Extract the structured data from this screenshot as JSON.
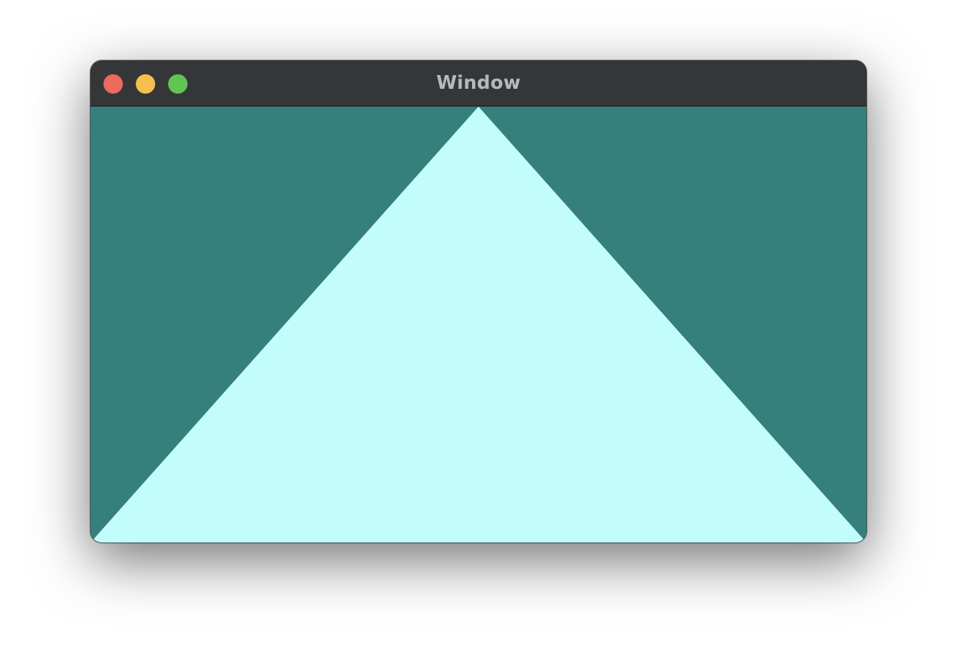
{
  "window": {
    "title": "Window"
  },
  "traffic_lights": {
    "close": {
      "icon": "close-icon",
      "color": "#ec6a5e"
    },
    "minimize": {
      "icon": "minimize-icon",
      "color": "#f5bf4f"
    },
    "zoom": {
      "icon": "zoom-icon",
      "color": "#61c554"
    }
  },
  "scene": {
    "clear_color": "#357f7c",
    "triangle_color": "#c2fdfc"
  }
}
